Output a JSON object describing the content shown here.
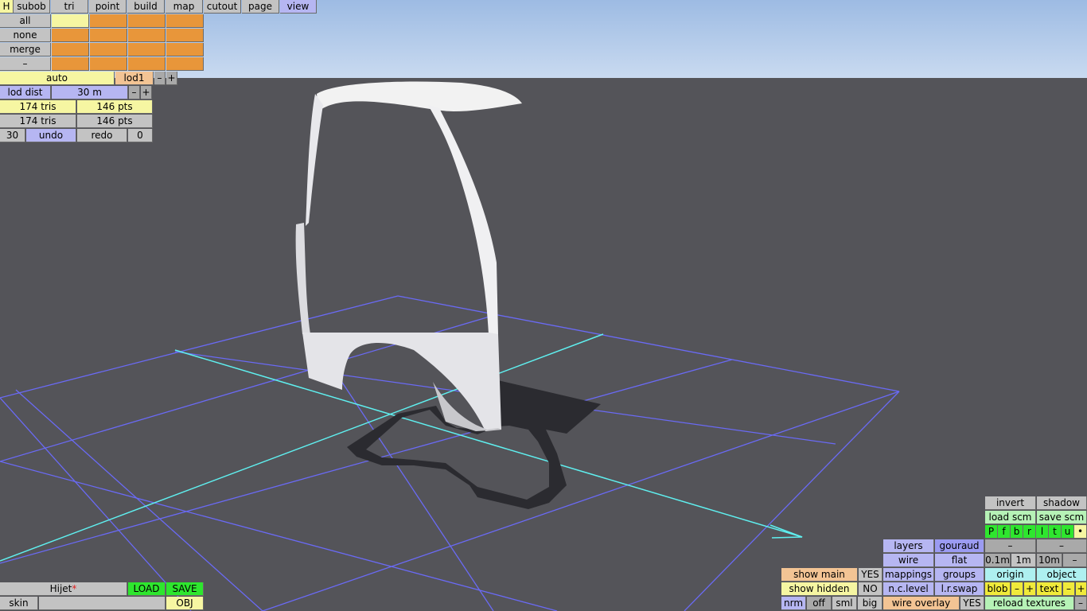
{
  "top_menu": {
    "h_label": "H",
    "tabs": [
      "subob",
      "tri",
      "point",
      "build",
      "map",
      "cutout",
      "page",
      "view"
    ],
    "active_tab": "view"
  },
  "select_panel": {
    "all": "all",
    "none": "none",
    "merge": "merge",
    "minus": "–"
  },
  "lod_panel": {
    "auto": "auto",
    "lod": "lod1",
    "minus": "–",
    "plus": "+",
    "lod_dist_label": "lod dist",
    "lod_dist_value": "30 m",
    "tris_1": "174 tris",
    "pts_1": "146 pts",
    "tris_2": "174 tris",
    "pts_2": "146 pts",
    "undo_count": "30",
    "undo": "undo",
    "redo": "redo",
    "redo_count": "0"
  },
  "file_panel": {
    "name": "Hijet",
    "modified_mark": "*",
    "load": "LOAD",
    "save": "SAVE",
    "skin": "skin",
    "obj": "OBJ"
  },
  "view_panel": {
    "show_main": "show main",
    "show_main_value": "YES",
    "show_hidden": "show hidden",
    "show_hidden_value": "NO",
    "normals": [
      "nrm",
      "off",
      "sml",
      "big"
    ],
    "layers": "layers",
    "gouraud": "gouraud",
    "wire": "wire",
    "flat": "flat",
    "mappings": "mappings",
    "groups": "groups",
    "nc_level": "n.c.level",
    "lr_swap": "l.r.swap",
    "wire_overlay": "wire overlay",
    "wire_overlay_value": "YES",
    "invert": "invert",
    "shadow": "shadow",
    "load_scm": "load scm",
    "save_scm": "save scm",
    "views": [
      "P",
      "f",
      "b",
      "r",
      "l",
      "t",
      "u",
      "•"
    ],
    "dash_a": "–",
    "dash_b": "–",
    "grid": [
      "0.1m",
      "1m",
      "10m",
      "–"
    ],
    "origin": "origin",
    "object": "object",
    "blob": "blob",
    "blob_minus": "–",
    "blob_plus": "+",
    "text": "text",
    "text_minus": "–",
    "text_plus": "+",
    "reload_textures": "reload textures",
    "reload_minus": "–"
  },
  "colors": {
    "sky": "#b4cbea",
    "ground": "#545459",
    "grid": "#6a6af5",
    "axis": "#5ff0f0",
    "model": "#f2f2f2"
  }
}
